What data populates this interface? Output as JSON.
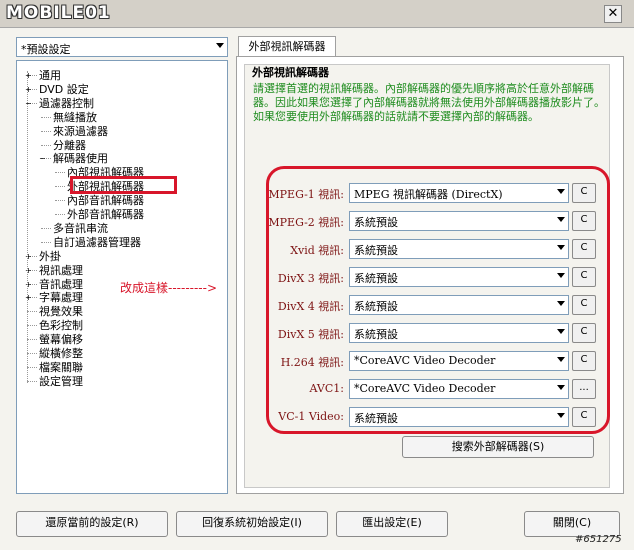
{
  "window": {
    "logo_text": "MOBILE01",
    "close_glyph": "✕"
  },
  "preset": {
    "value": "*預設設定"
  },
  "tree": [
    {
      "label": "通用",
      "expander": "+"
    },
    {
      "label": "DVD 設定",
      "expander": "+"
    },
    {
      "label": "過濾器控制",
      "expander": "−"
    },
    {
      "label": "無縫播放"
    },
    {
      "label": "來源過濾器"
    },
    {
      "label": "分離器"
    },
    {
      "label": "解碼器使用",
      "expander": "−"
    },
    {
      "label": "內部視訊解碼器"
    },
    {
      "label": "外部視訊解碼器"
    },
    {
      "label": "內部音訊解碼器"
    },
    {
      "label": "外部音訊解碼器"
    },
    {
      "label": "多音訊串流"
    },
    {
      "label": "自訂過濾器管理器"
    },
    {
      "label": "外掛",
      "expander": "+"
    },
    {
      "label": "視訊處理",
      "expander": "+"
    },
    {
      "label": "音訊處理",
      "expander": "+"
    },
    {
      "label": "字幕處理",
      "expander": "+"
    },
    {
      "label": "視覺效果"
    },
    {
      "label": "色彩控制"
    },
    {
      "label": "螢幕偏移"
    },
    {
      "label": "縱橫修整"
    },
    {
      "label": "檔案關聯"
    },
    {
      "label": "設定管理"
    }
  ],
  "tab": {
    "label": "外部視訊解碼器"
  },
  "group": {
    "title": "外部視訊解碼器",
    "description": "請選擇首選的視訊解碼器。內部解碼器的優先順序將高於任意外部解碼器。因此如果您選擇了內部解碼器就將無法使用外部解碼器播放影片了。如果您要使用外部解碼器的話就請不要選擇內部的解碼器。"
  },
  "decoders": [
    {
      "label": "MPEG-1 視訊:",
      "value": "MPEG 視訊解碼器 (DirectX)",
      "button": "C"
    },
    {
      "label": "MPEG-2 視訊:",
      "value": "系統預設",
      "button": "C"
    },
    {
      "label": "Xvid 視訊:",
      "value": "系統預設",
      "button": "C"
    },
    {
      "label": "DivX 3 視訊:",
      "value": "系統預設",
      "button": "C"
    },
    {
      "label": "DivX 4 視訊:",
      "value": "系統預設",
      "button": "C"
    },
    {
      "label": "DivX 5 視訊:",
      "value": "系統預設",
      "button": "C"
    },
    {
      "label": "H.264 視訊:",
      "value": "*CoreAVC Video Decoder",
      "button": "C"
    },
    {
      "label": "AVC1:",
      "value": "*CoreAVC Video Decoder",
      "button": "..."
    },
    {
      "label": "VC-1 Video:",
      "value": "系統預設",
      "button": "C"
    }
  ],
  "annotation": {
    "text": "改成這樣--------->"
  },
  "search_button": "搜索外部解碼器(S)",
  "bottom_buttons": {
    "restore": "還原當前的設定(R)",
    "reset": "回復系統初始設定(I)",
    "export": "匯出設定(E)",
    "close": "關閉(C)"
  },
  "watermark": "#651275",
  "colors": {
    "accent_red": "#d8162a",
    "description_green": "#1e8c1e",
    "label_maroon": "#7d1313"
  }
}
